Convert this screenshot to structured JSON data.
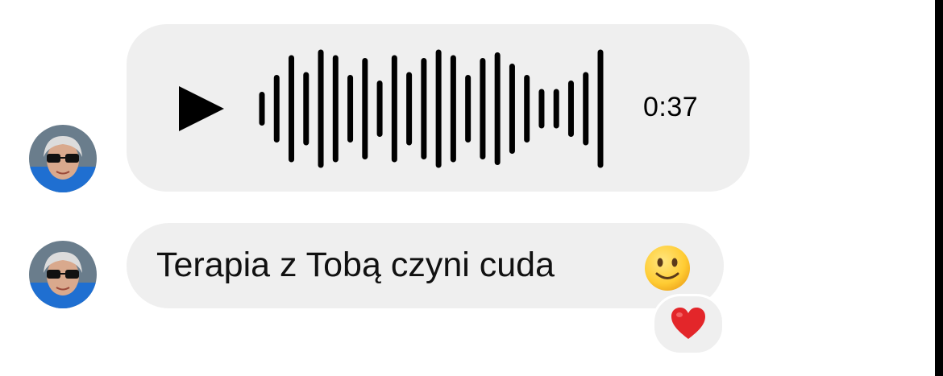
{
  "conversation": {
    "messages": [
      {
        "type": "voice",
        "duration": "0:37",
        "play_icon": "play-icon",
        "waveform_bars": [
          0.25,
          0.55,
          0.9,
          0.6,
          1.0,
          0.9,
          0.55,
          0.85,
          0.45,
          0.9,
          0.6,
          0.85,
          1.0,
          0.9,
          0.55,
          0.85,
          0.95,
          0.75,
          0.55,
          0.3,
          0.3,
          0.45,
          0.6,
          1.0
        ]
      },
      {
        "type": "text",
        "text": "Terapia z Tobą czyni cuda",
        "inline_emoji": "slightly-smiling-face-icon",
        "reaction": "red-heart-icon"
      }
    ]
  },
  "colors": {
    "bubble": "#efefef",
    "text": "#111111",
    "waveform": "#000000",
    "heart": "#e3262a",
    "emoji_face": "#ffcc33"
  }
}
